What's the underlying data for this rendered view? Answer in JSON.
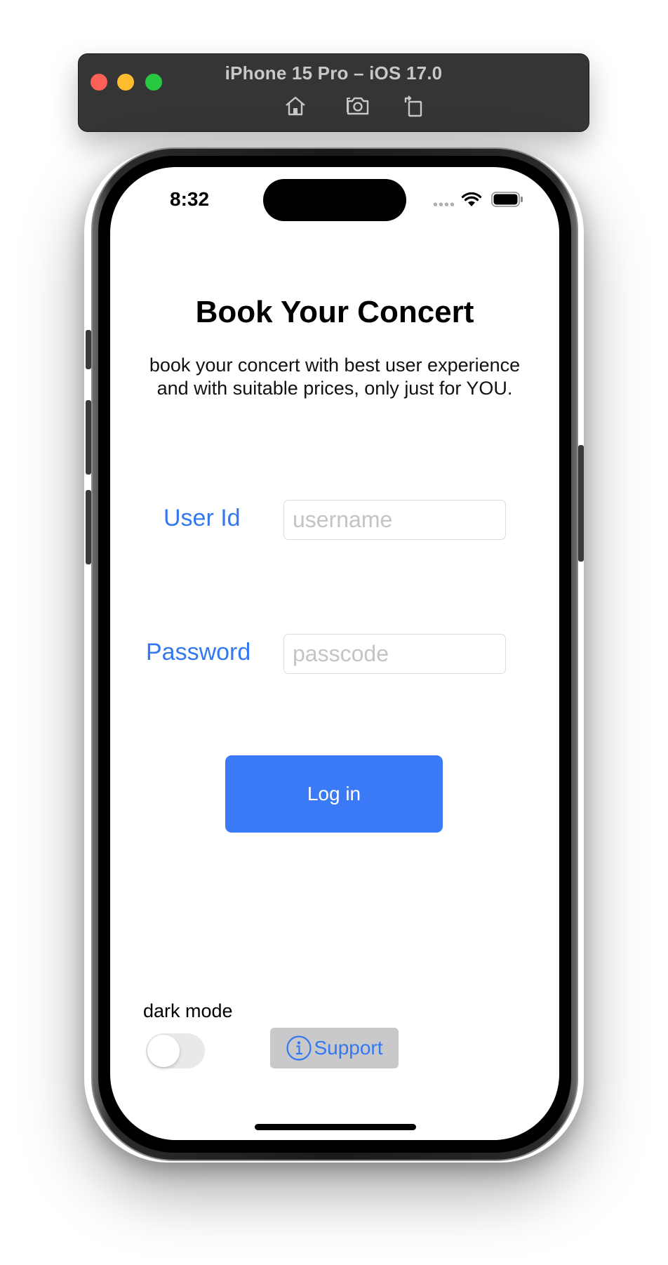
{
  "simulator": {
    "title": "iPhone 15 Pro – iOS 17.0",
    "icons": [
      "home-icon",
      "screenshot-icon",
      "rotate-icon"
    ]
  },
  "status_bar": {
    "time": "8:32",
    "signal": "••••"
  },
  "login": {
    "title": "Book Your Concert",
    "subtitle": "book your concert with best user experience and with suitable prices, only just for YOU.",
    "user_id_label": "User Id",
    "user_id_placeholder": "username",
    "user_id_value": "",
    "password_label": "Password",
    "password_placeholder": "passcode",
    "password_value": "",
    "login_button": "Log in"
  },
  "footer": {
    "dark_mode_label": "dark mode",
    "dark_mode_on": false,
    "support_label": "Support"
  },
  "colors": {
    "accent": "#3a7af6",
    "label_blue": "#3478f0",
    "support_bg": "#c9c9cc"
  }
}
